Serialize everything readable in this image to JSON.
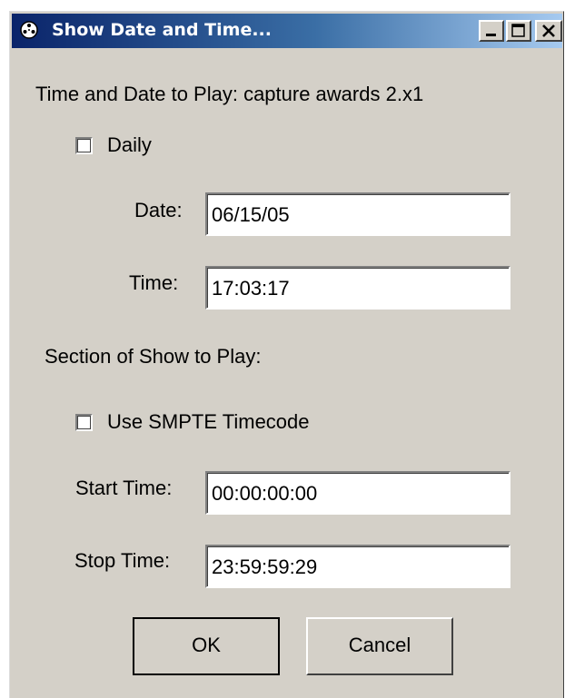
{
  "window": {
    "title": "Show Date and Time...",
    "icon": "film-reel-icon",
    "controls": {
      "minimize_icon": "minimize-icon",
      "maximize_icon": "maximize-icon",
      "close_icon": "close-icon"
    }
  },
  "play_time": {
    "heading": "Time and Date to Play:  capture awards 2.x1",
    "daily_label": "Daily",
    "daily_checked": false,
    "date_label": "Date:",
    "date_value": "06/15/05",
    "time_label": "Time:",
    "time_value": "17:03:17"
  },
  "section": {
    "heading": "Section of Show to Play:",
    "smpte_label": "Use SMPTE Timecode",
    "smpte_checked": false,
    "start_label": "Start Time:",
    "start_value": "00:00:00:00",
    "stop_label": "Stop Time:",
    "stop_value": "23:59:59:29"
  },
  "buttons": {
    "ok": "OK",
    "cancel": "Cancel"
  },
  "colors": {
    "face": "#d4d0c8",
    "titlebar_start": "#0a246a",
    "titlebar_end": "#a6caf0"
  }
}
